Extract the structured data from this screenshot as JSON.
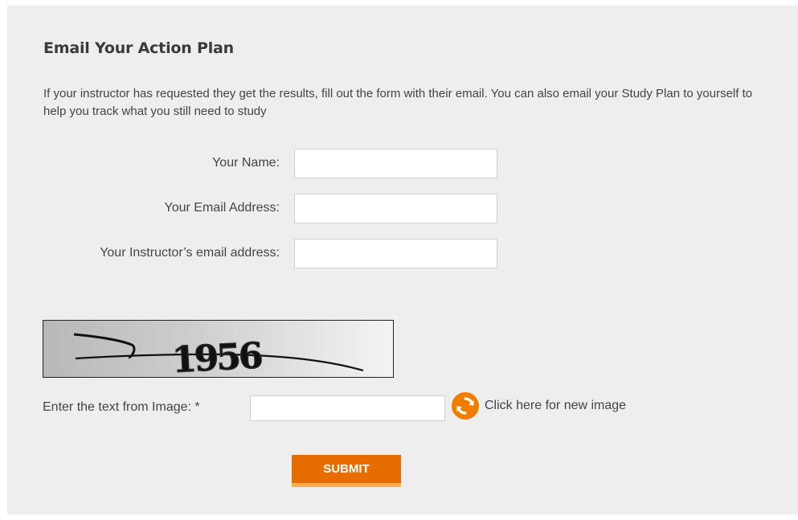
{
  "heading": "Email Your Action Plan",
  "intro": "If your instructor has requested they get the results, fill out the form with their email. You can also email your Study Plan to yourself to help you track what you still need to study",
  "form": {
    "name_label": "Your Name:",
    "name_value": "",
    "email_label": "Your Email Address:",
    "email_value": "",
    "instructor_label": "Your Instructor’s email address:",
    "instructor_value": ""
  },
  "captcha": {
    "image_text": "1956",
    "label": "Enter the text from Image: *",
    "value": "",
    "refresh_label": "Click here for new image",
    "refresh_icon": "refresh-icon"
  },
  "submit_label": "SUBMIT",
  "colors": {
    "accent": "#e86d00",
    "accent_light": "#f7b14a",
    "panel": "#eeeeee",
    "text": "#444444"
  }
}
